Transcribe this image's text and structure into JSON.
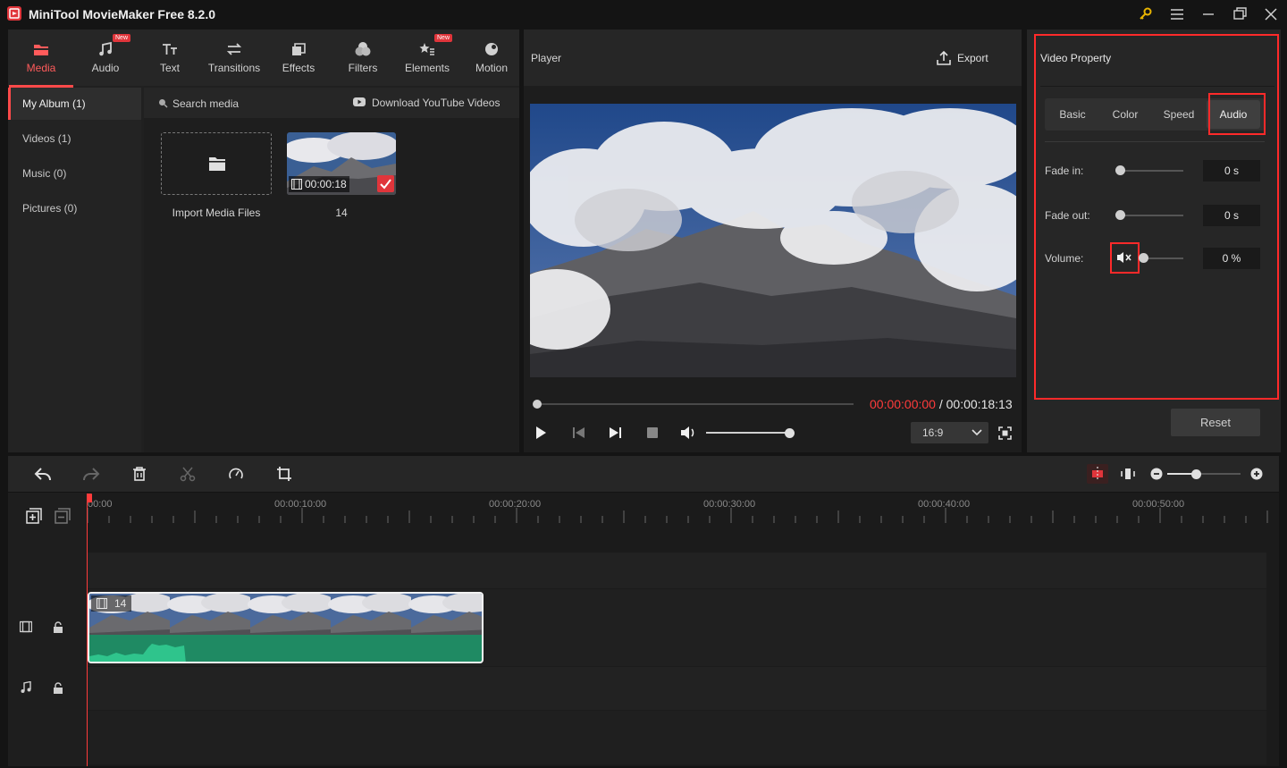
{
  "app": {
    "title": "MiniTool MovieMaker Free 8.2.0"
  },
  "toolbar": {
    "tabs": [
      {
        "label": "Media",
        "icon": "media-folder-icon",
        "active": true,
        "new": false
      },
      {
        "label": "Audio",
        "icon": "music-note-icon",
        "active": false,
        "new": true
      },
      {
        "label": "Text",
        "icon": "text-icon",
        "active": false,
        "new": false
      },
      {
        "label": "Transitions",
        "icon": "transitions-icon",
        "active": false,
        "new": false
      },
      {
        "label": "Effects",
        "icon": "effects-icon",
        "active": false,
        "new": false
      },
      {
        "label": "Filters",
        "icon": "filters-icon",
        "active": false,
        "new": false
      },
      {
        "label": "Elements",
        "icon": "elements-icon",
        "active": false,
        "new": true
      },
      {
        "label": "Motion",
        "icon": "motion-icon",
        "active": false,
        "new": false
      }
    ],
    "new_badge": "New"
  },
  "sidebar": {
    "items": [
      {
        "label": "My Album (1)",
        "active": true
      },
      {
        "label": "Videos (1)",
        "active": false
      },
      {
        "label": "Music (0)",
        "active": false
      },
      {
        "label": "Pictures (0)",
        "active": false
      }
    ]
  },
  "library": {
    "search_label": "Search media",
    "download_label": "Download YouTube Videos",
    "import_label": "Import Media Files",
    "clip": {
      "name": "14",
      "duration": "00:00:18"
    }
  },
  "player": {
    "title": "Player",
    "export_label": "Export",
    "current_time": "00:00:00:00",
    "separator": " / ",
    "total_time": "00:00:18:13",
    "aspect_ratio": "16:9",
    "progress": 0,
    "volume": 1.0
  },
  "property": {
    "title": "Video Property",
    "tabs": [
      "Basic",
      "Color",
      "Speed",
      "Audio"
    ],
    "active_tab": "Audio",
    "fade_in_label": "Fade in:",
    "fade_in_value": "0 s",
    "fade_out_label": "Fade out:",
    "fade_out_value": "0 s",
    "volume_label": "Volume:",
    "volume_value": "0 %",
    "reset_label": "Reset"
  },
  "timeline": {
    "ticks": [
      "00:00",
      "00:00:10:00",
      "00:00:20:00",
      "00:00:30:00",
      "00:00:40:00",
      "00:00:50:00"
    ],
    "clip_name": "14",
    "zoom": 0.4
  },
  "colors": {
    "accent": "#ff4a4a",
    "highlight_box": "#ff2a2a",
    "audio_wave": "#1f8a63",
    "audio_wave_peak": "#2fc48c"
  }
}
